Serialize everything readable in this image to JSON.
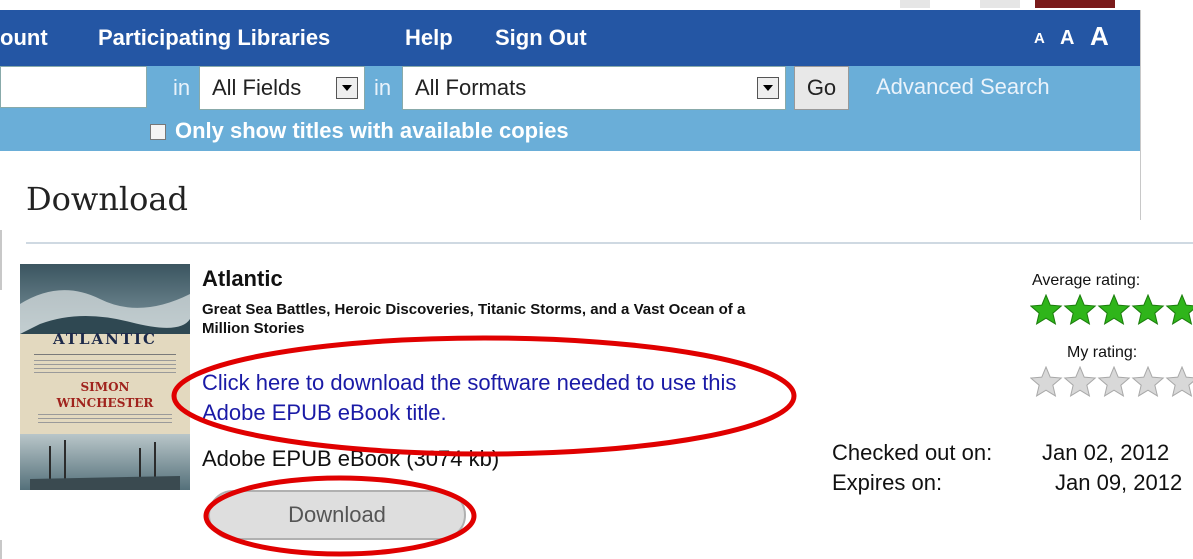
{
  "nav": {
    "items": [
      "ount",
      "Participating Libraries",
      "Help",
      "Sign Out"
    ],
    "font_sizes": [
      "A",
      "A",
      "A"
    ]
  },
  "search": {
    "in_label": "in",
    "field_select": "All Fields",
    "format_select": "All Formats",
    "go_label": "Go",
    "advanced_label": "Advanced Search",
    "available_only_label": "Only show titles with available copies"
  },
  "page": {
    "title": "Download"
  },
  "book": {
    "title": "Atlantic",
    "subtitle": "Great Sea Battles, Heroic Discoveries, Titanic Storms, and a Vast Ocean of a Million Stories",
    "software_link": "Click here to download the software needed to use this Adobe EPUB eBook title.",
    "format": "Adobe EPUB eBook (3074 kb)",
    "download_label": "Download",
    "cover": {
      "title": "ATLANTIC",
      "author_first": "SIMON",
      "author_last": "WINCHESTER"
    }
  },
  "ratings": {
    "average_label": "Average rating:",
    "average_stars": 5,
    "my_label": "My rating:",
    "my_stars": 0
  },
  "checkout": {
    "checked_out_label": "Checked out on:",
    "checked_out_value": "Jan 02, 2012",
    "expires_label": "Expires on:",
    "expires_value": "Jan 09, 2012"
  },
  "colors": {
    "nav_bg": "#2456a4",
    "search_bg": "#6aaed8",
    "link": "#1a1aa6",
    "star_filled": "#2fb51a",
    "star_empty": "#d8d8d8",
    "annotation": "#e00000"
  }
}
